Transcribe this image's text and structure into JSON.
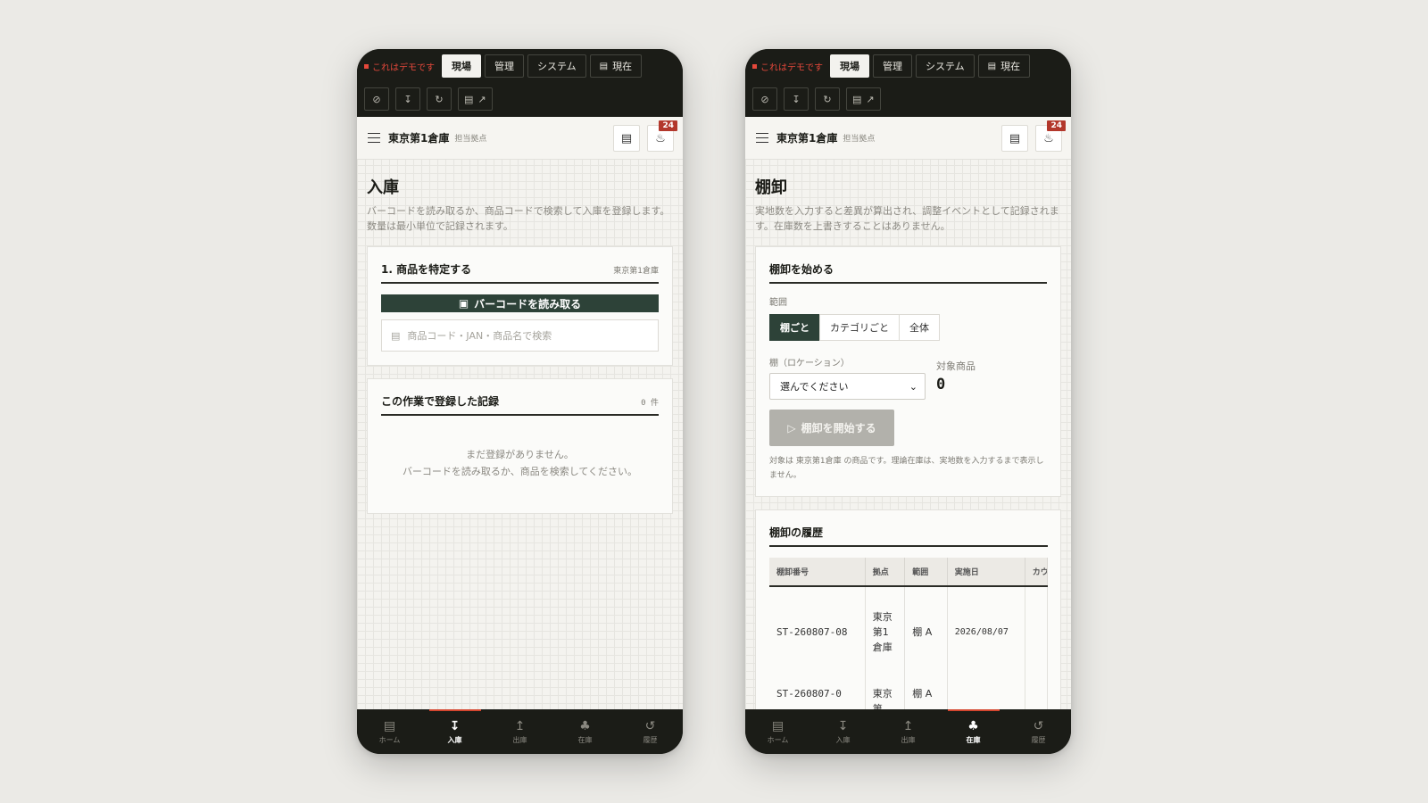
{
  "colors": {
    "accent": "#2d4238",
    "alert": "#b3382c",
    "demo": "#e5483b",
    "dark_bar": "#1b1c17"
  },
  "topbar": {
    "demo_label": "これはデモです",
    "tabs": [
      {
        "label": "現場",
        "active": true
      },
      {
        "label": "管理",
        "active": false
      },
      {
        "label": "システム",
        "active": false
      },
      {
        "label": "現在",
        "active": false,
        "icon": "calendar-icon"
      }
    ],
    "tools": [
      "wifi-off-icon",
      "download-icon",
      "refresh-icon",
      "print-external-icon"
    ]
  },
  "header": {
    "site_name": "東京第1倉庫",
    "site_sub": "担当拠点",
    "notification_count": "24"
  },
  "receiving": {
    "title": "入庫",
    "description": "バーコードを読み取るか、商品コードで検索して入庫を登録します。数量は最小単位で記録されます。",
    "step_title": "1. 商品を特定する",
    "step_meta": "東京第1倉庫",
    "scan_label": "バーコードを読み取る",
    "search_placeholder": "商品コード・JAN・商品名で検索",
    "records_title": "この作業で登録した記録",
    "records_count": "0 件",
    "empty_line1": "まだ登録がありません。",
    "empty_line2": "バーコードを読み取るか、商品を検索してください。"
  },
  "stocktake": {
    "title": "棚卸",
    "description": "実地数を入力すると差異が算出され、調整イベントとして記録されます。在庫数を上書きすることはありません。",
    "start_card_title": "棚卸を始める",
    "scope_label": "範囲",
    "scope_options": [
      "棚ごと",
      "カテゴリごと",
      "全体"
    ],
    "scope_selected": "棚ごと",
    "shelf_label": "棚（ロケーション）",
    "shelf_value": "選んでください",
    "target_label": "対象商品",
    "target_count": "0",
    "start_button": "棚卸を開始する",
    "note": "対象は 東京第1倉庫 の商品です。理論在庫は、実地数を入力するまで表示しません。",
    "history_title": "棚卸の履歴",
    "history_columns": [
      "棚卸番号",
      "拠点",
      "範囲",
      "実施日",
      "カウ"
    ],
    "history_rows": [
      [
        "ST-260807-08",
        "東京第1倉庫",
        "棚 A",
        "2026/08/07",
        ""
      ],
      [
        "ST-260807-0",
        "東京第",
        "棚 A",
        "",
        ""
      ]
    ]
  },
  "bottom_nav": [
    {
      "label": "ホーム",
      "icon": "home-icon"
    },
    {
      "label": "入庫",
      "icon": "receive-icon"
    },
    {
      "label": "出庫",
      "icon": "ship-icon"
    },
    {
      "label": "在庫",
      "icon": "stock-icon"
    },
    {
      "label": "履歴",
      "icon": "history-icon"
    }
  ]
}
